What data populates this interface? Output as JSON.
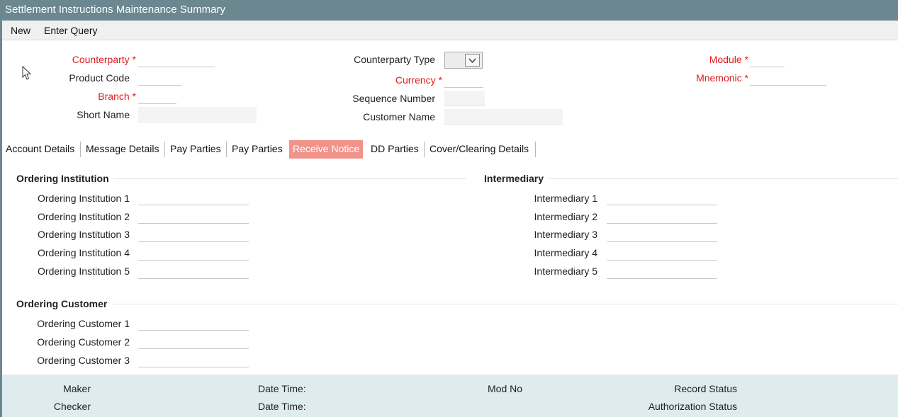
{
  "window": {
    "title": "Settlement Instructions Maintenance Summary"
  },
  "toolbar": {
    "new_label": "New",
    "enter_query_label": "Enter Query"
  },
  "header": {
    "counterparty_label": "Counterparty",
    "product_code_label": "Product Code",
    "branch_label": "Branch",
    "short_name_label": "Short Name",
    "counterparty_type_label": "Counterparty Type",
    "currency_label": "Currency",
    "sequence_number_label": "Sequence Number",
    "customer_name_label": "Customer Name",
    "module_label": "Module",
    "mnemonic_label": "Mnemonic",
    "required_marker": "*"
  },
  "tabs": [
    {
      "label": "Account Details"
    },
    {
      "label": "Message Details"
    },
    {
      "label": "Pay Parties"
    },
    {
      "label": "Pay Parties"
    },
    {
      "label": "Receive Notice"
    },
    {
      "label": "DD Parties"
    },
    {
      "label": "Cover/Clearing Details"
    }
  ],
  "active_tab": "Receive Notice",
  "ordering_institution": {
    "title": "Ordering Institution",
    "fields": [
      "Ordering Institution 1",
      "Ordering Institution 2",
      "Ordering Institution 3",
      "Ordering Institution 4",
      "Ordering Institution 5"
    ]
  },
  "intermediary": {
    "title": "Intermediary",
    "fields": [
      "Intermediary 1",
      "Intermediary 2",
      "Intermediary 3",
      "Intermediary 4",
      "Intermediary 5"
    ]
  },
  "ordering_customer": {
    "title": "Ordering Customer",
    "fields": [
      "Ordering Customer 1",
      "Ordering Customer 2",
      "Ordering Customer 3"
    ]
  },
  "footer": {
    "maker_label": "Maker",
    "checker_label": "Checker",
    "date_time_label_1": "Date Time:",
    "date_time_label_2": "Date Time:",
    "mod_no_label": "Mod No",
    "record_status_label": "Record Status",
    "authorization_status_label": "Authorization Status"
  },
  "colors": {
    "title_bar": "#6b8790",
    "active_tab": "#f1938a",
    "required": "#e01a1a",
    "footer_bg": "#deebef"
  },
  "icons": {
    "cursor": "mouse-pointer-icon",
    "dropdown": "chevron-down-icon"
  }
}
